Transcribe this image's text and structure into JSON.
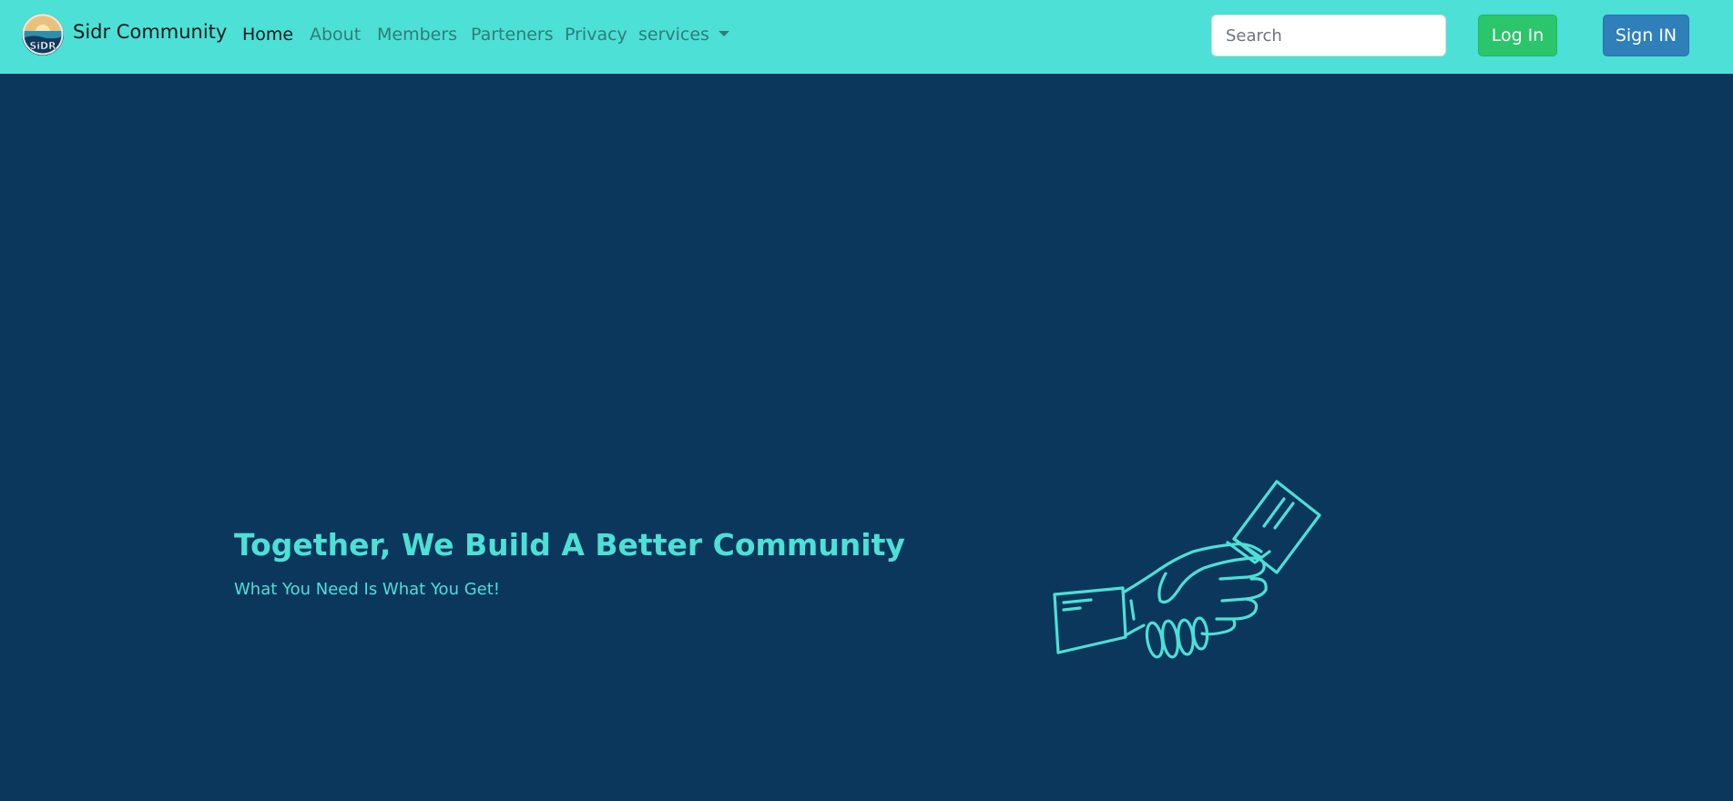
{
  "brand": {
    "name": "Sidr Community",
    "logo_text": "SiDR"
  },
  "nav": {
    "items": [
      {
        "label": "Home",
        "active": true
      },
      {
        "label": "About",
        "active": false
      },
      {
        "label": "Members",
        "active": false
      },
      {
        "label": "Parteners",
        "active": false
      },
      {
        "label": "Privacy",
        "active": false
      },
      {
        "label": "services",
        "active": false,
        "dropdown": true
      }
    ]
  },
  "search": {
    "placeholder": "Search",
    "value": ""
  },
  "auth": {
    "login_label": "Log In",
    "signin_label": "Sign IN"
  },
  "hero": {
    "title": "Together, We Build A Better Community",
    "subtitle": "What You Need Is What You Get!",
    "illustration": "handshake-icon"
  },
  "colors": {
    "navbar_bg": "#4ce0d6",
    "page_bg": "#0b375d",
    "accent": "#4ce0d6",
    "login_btn": "#2bc56c",
    "signin_btn": "#2f7fbb"
  }
}
